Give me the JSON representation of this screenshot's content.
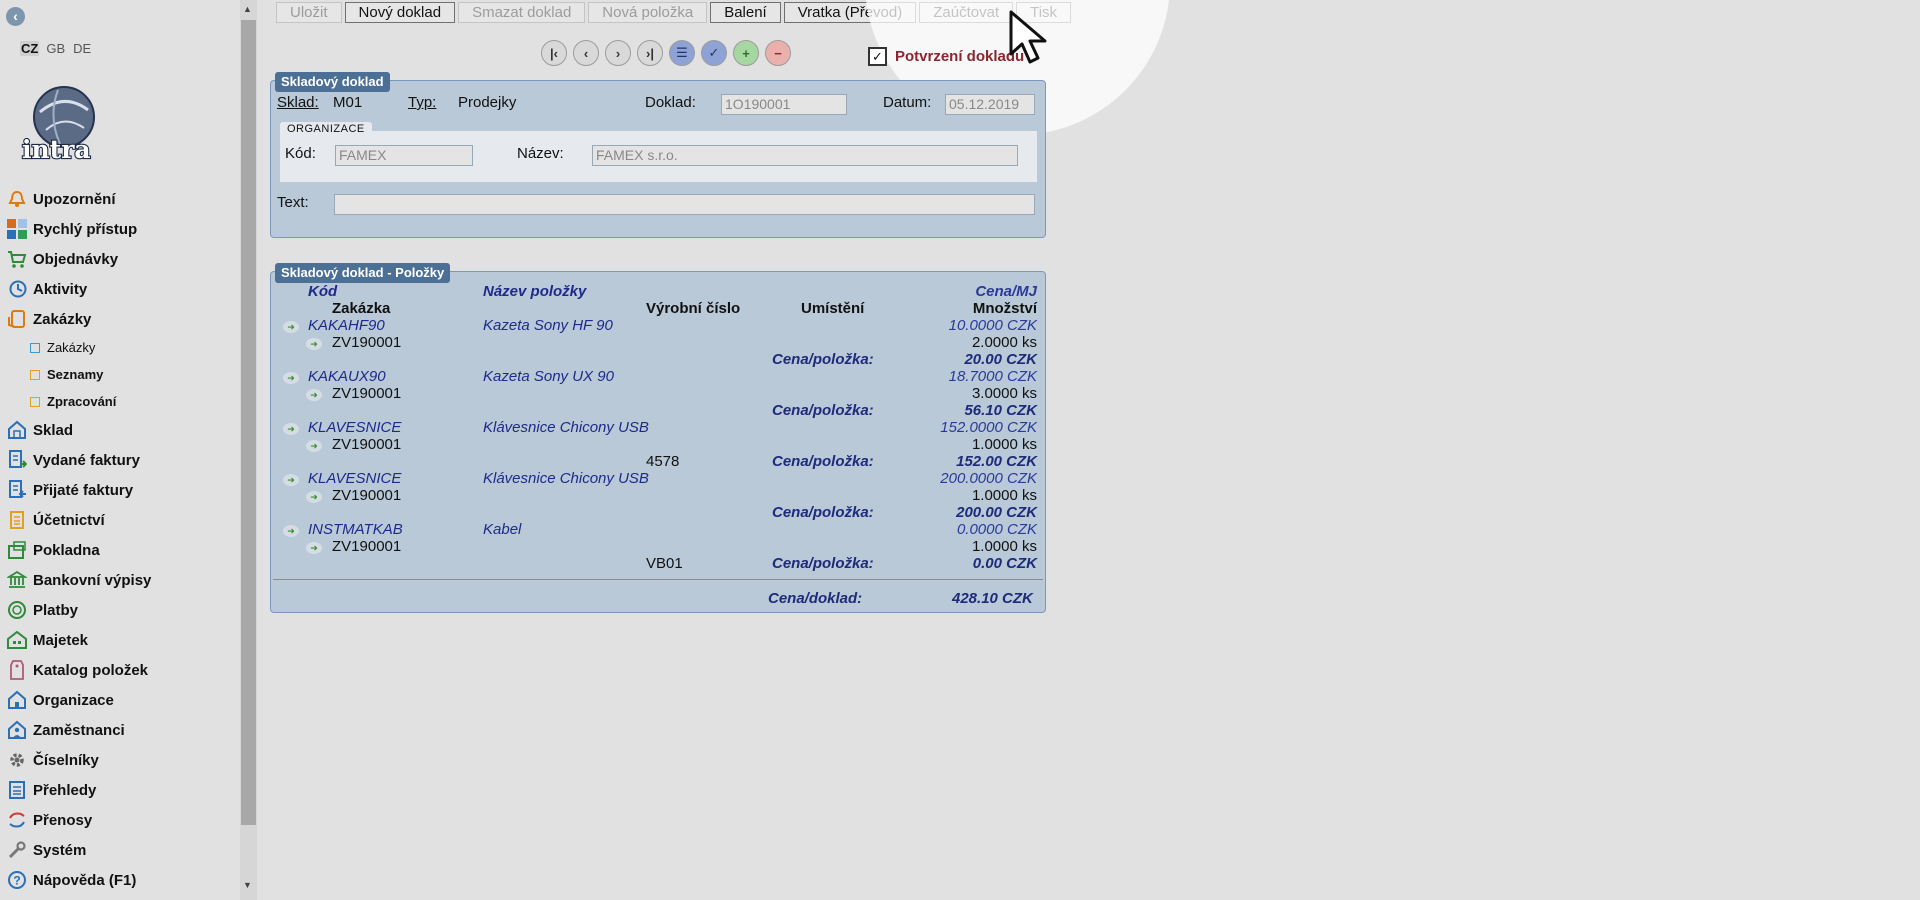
{
  "languages": [
    "CZ",
    "GB",
    "DE"
  ],
  "menu": [
    {
      "label": "Upozornění",
      "icon": "bell-icon"
    },
    {
      "label": "Rychlý přístup",
      "icon": "tiles-icon"
    },
    {
      "label": "Objednávky",
      "icon": "cart-icon"
    },
    {
      "label": "Aktivity",
      "icon": "clock-icon"
    },
    {
      "label": "Zakázky",
      "icon": "phone-icon"
    },
    {
      "label": "Zakázky",
      "icon": "folder-blue-icon",
      "sub": true
    },
    {
      "label": "Seznamy",
      "icon": "folder-icon",
      "sub": true,
      "bold": true
    },
    {
      "label": "Zpracování",
      "icon": "folder-icon",
      "sub": true,
      "bold": true
    },
    {
      "label": "Sklad",
      "icon": "warehouse-icon"
    },
    {
      "label": "Vydané faktury",
      "icon": "invoice-out-icon"
    },
    {
      "label": "Přijaté faktury",
      "icon": "invoice-in-icon"
    },
    {
      "label": "Účetnictví",
      "icon": "ledger-icon"
    },
    {
      "label": "Pokladna",
      "icon": "cash-icon"
    },
    {
      "label": "Bankovní výpisy",
      "icon": "bank-icon"
    },
    {
      "label": "Platby",
      "icon": "coin-icon"
    },
    {
      "label": "Majetek",
      "icon": "property-icon"
    },
    {
      "label": "Katalog položek",
      "icon": "tag-icon"
    },
    {
      "label": "Organizace",
      "icon": "building-icon"
    },
    {
      "label": "Zaměstnanci",
      "icon": "person-icon"
    },
    {
      "label": "Číselníky",
      "icon": "gear-icon"
    },
    {
      "label": "Přehledy",
      "icon": "list-icon"
    },
    {
      "label": "Přenosy",
      "icon": "sync-icon"
    },
    {
      "label": "Systém",
      "icon": "wrench-icon"
    },
    {
      "label": "Nápověda (F1)",
      "icon": "help-icon"
    }
  ],
  "toolbar": {
    "save": "Uložit",
    "new_doc": "Nový doklad",
    "delete_doc": "Smazat doklad",
    "new_item": "Nová položka",
    "packing": "Balení",
    "return": "Vratka (Převod)",
    "post": "Zaúčtovat",
    "print": "Tisk"
  },
  "confirm_label": "Potvrzení dokladu",
  "doc": {
    "title": "Skladový doklad",
    "sklad_label": "Sklad:",
    "sklad_value": "M01",
    "typ_label": "Typ:",
    "typ_value": "Prodejky",
    "doklad_label": "Doklad:",
    "doklad_value": "1O190001",
    "datum_label": "Datum:",
    "datum_value": "05.12.2019",
    "org_title": "ORGANIZACE",
    "kod_label": "Kód:",
    "kod_value": "FAMEX",
    "nazev_label": "Název:",
    "nazev_value": "FAMEX s.r.o.",
    "text_label": "Text:",
    "text_value": ""
  },
  "items": {
    "title": "Skladový doklad - Položky",
    "headers": {
      "code": "Kód",
      "order": "Zakázka",
      "name": "Název položky",
      "serial": "Výrobní číslo",
      "location": "Umístění",
      "price_unit": "Cena/MJ",
      "qty": "Množství"
    },
    "price_item_label": "Cena/položka:",
    "rows": [
      {
        "code": "KAKAHF90",
        "name": "Kazeta Sony HF 90",
        "order": "ZV190001",
        "serial": "",
        "price": "10.0000 CZK",
        "qty": "2.0000 ks",
        "total": "20.00 CZK"
      },
      {
        "code": "KAKAUX90",
        "name": "Kazeta Sony UX 90",
        "order": "ZV190001",
        "serial": "",
        "price": "18.7000 CZK",
        "qty": "3.0000 ks",
        "total": "56.10 CZK"
      },
      {
        "code": "KLAVESNICE",
        "name": "Klávesnice Chicony USB",
        "order": "ZV190001",
        "serial": "4578",
        "price": "152.0000 CZK",
        "qty": "1.0000 ks",
        "total": "152.00 CZK"
      },
      {
        "code": "KLAVESNICE",
        "name": "Klávesnice Chicony USB",
        "order": "ZV190001",
        "serial": "",
        "price": "200.0000 CZK",
        "qty": "1.0000 ks",
        "total": "200.00 CZK"
      },
      {
        "code": "INSTMATKAB",
        "name": "Kabel",
        "order": "ZV190001",
        "serial": "VB01",
        "price": "0.0000 CZK",
        "qty": "1.0000 ks",
        "total": "0.00 CZK"
      }
    ],
    "doc_total_label": "Cena/doklad:",
    "doc_total_value": "428.10",
    "doc_total_currency": "CZK"
  }
}
